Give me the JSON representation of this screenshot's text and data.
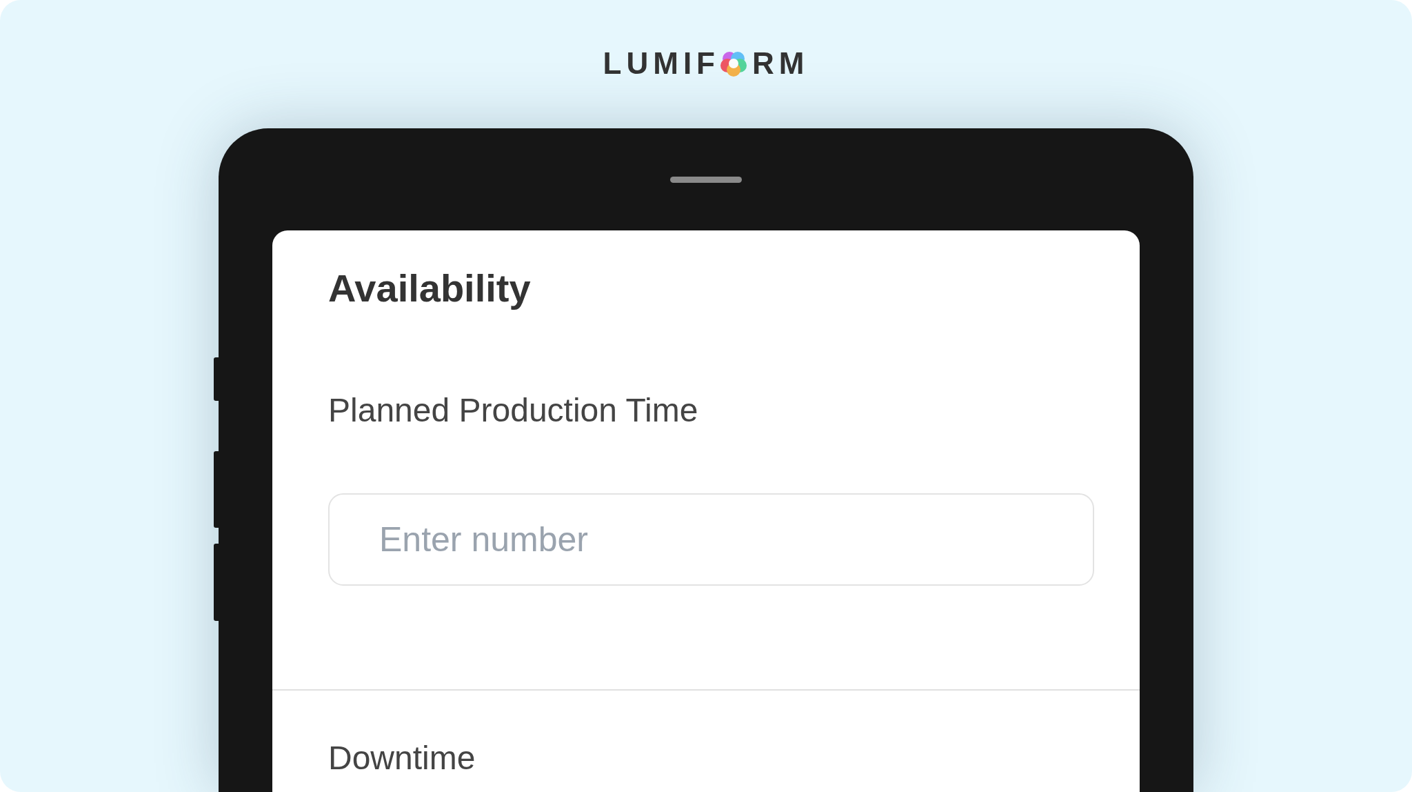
{
  "logo": {
    "text_before": "LUMIF",
    "text_after": "RM"
  },
  "screen": {
    "heading": "Availability",
    "fields": [
      {
        "label": "Planned Production Time",
        "placeholder": "Enter number"
      }
    ],
    "next_section": {
      "label": "Downtime"
    }
  }
}
